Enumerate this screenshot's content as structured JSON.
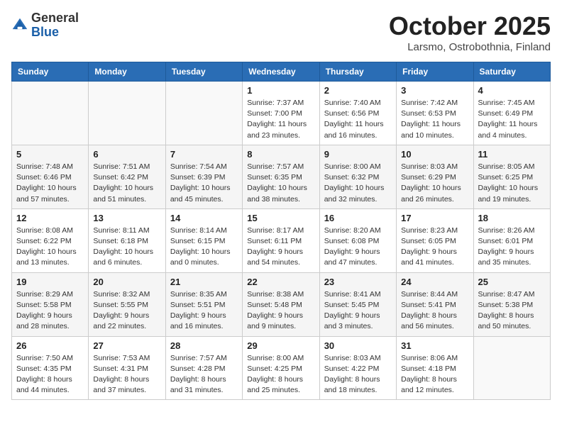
{
  "header": {
    "logo_general": "General",
    "logo_blue": "Blue",
    "month_title": "October 2025",
    "location": "Larsmo, Ostrobothnia, Finland"
  },
  "weekdays": [
    "Sunday",
    "Monday",
    "Tuesday",
    "Wednesday",
    "Thursday",
    "Friday",
    "Saturday"
  ],
  "weeks": [
    [
      {
        "day": "",
        "info": ""
      },
      {
        "day": "",
        "info": ""
      },
      {
        "day": "",
        "info": ""
      },
      {
        "day": "1",
        "info": "Sunrise: 7:37 AM\nSunset: 7:00 PM\nDaylight: 11 hours\nand 23 minutes."
      },
      {
        "day": "2",
        "info": "Sunrise: 7:40 AM\nSunset: 6:56 PM\nDaylight: 11 hours\nand 16 minutes."
      },
      {
        "day": "3",
        "info": "Sunrise: 7:42 AM\nSunset: 6:53 PM\nDaylight: 11 hours\nand 10 minutes."
      },
      {
        "day": "4",
        "info": "Sunrise: 7:45 AM\nSunset: 6:49 PM\nDaylight: 11 hours\nand 4 minutes."
      }
    ],
    [
      {
        "day": "5",
        "info": "Sunrise: 7:48 AM\nSunset: 6:46 PM\nDaylight: 10 hours\nand 57 minutes."
      },
      {
        "day": "6",
        "info": "Sunrise: 7:51 AM\nSunset: 6:42 PM\nDaylight: 10 hours\nand 51 minutes."
      },
      {
        "day": "7",
        "info": "Sunrise: 7:54 AM\nSunset: 6:39 PM\nDaylight: 10 hours\nand 45 minutes."
      },
      {
        "day": "8",
        "info": "Sunrise: 7:57 AM\nSunset: 6:35 PM\nDaylight: 10 hours\nand 38 minutes."
      },
      {
        "day": "9",
        "info": "Sunrise: 8:00 AM\nSunset: 6:32 PM\nDaylight: 10 hours\nand 32 minutes."
      },
      {
        "day": "10",
        "info": "Sunrise: 8:03 AM\nSunset: 6:29 PM\nDaylight: 10 hours\nand 26 minutes."
      },
      {
        "day": "11",
        "info": "Sunrise: 8:05 AM\nSunset: 6:25 PM\nDaylight: 10 hours\nand 19 minutes."
      }
    ],
    [
      {
        "day": "12",
        "info": "Sunrise: 8:08 AM\nSunset: 6:22 PM\nDaylight: 10 hours\nand 13 minutes."
      },
      {
        "day": "13",
        "info": "Sunrise: 8:11 AM\nSunset: 6:18 PM\nDaylight: 10 hours\nand 6 minutes."
      },
      {
        "day": "14",
        "info": "Sunrise: 8:14 AM\nSunset: 6:15 PM\nDaylight: 10 hours\nand 0 minutes."
      },
      {
        "day": "15",
        "info": "Sunrise: 8:17 AM\nSunset: 6:11 PM\nDaylight: 9 hours\nand 54 minutes."
      },
      {
        "day": "16",
        "info": "Sunrise: 8:20 AM\nSunset: 6:08 PM\nDaylight: 9 hours\nand 47 minutes."
      },
      {
        "day": "17",
        "info": "Sunrise: 8:23 AM\nSunset: 6:05 PM\nDaylight: 9 hours\nand 41 minutes."
      },
      {
        "day": "18",
        "info": "Sunrise: 8:26 AM\nSunset: 6:01 PM\nDaylight: 9 hours\nand 35 minutes."
      }
    ],
    [
      {
        "day": "19",
        "info": "Sunrise: 8:29 AM\nSunset: 5:58 PM\nDaylight: 9 hours\nand 28 minutes."
      },
      {
        "day": "20",
        "info": "Sunrise: 8:32 AM\nSunset: 5:55 PM\nDaylight: 9 hours\nand 22 minutes."
      },
      {
        "day": "21",
        "info": "Sunrise: 8:35 AM\nSunset: 5:51 PM\nDaylight: 9 hours\nand 16 minutes."
      },
      {
        "day": "22",
        "info": "Sunrise: 8:38 AM\nSunset: 5:48 PM\nDaylight: 9 hours\nand 9 minutes."
      },
      {
        "day": "23",
        "info": "Sunrise: 8:41 AM\nSunset: 5:45 PM\nDaylight: 9 hours\nand 3 minutes."
      },
      {
        "day": "24",
        "info": "Sunrise: 8:44 AM\nSunset: 5:41 PM\nDaylight: 8 hours\nand 56 minutes."
      },
      {
        "day": "25",
        "info": "Sunrise: 8:47 AM\nSunset: 5:38 PM\nDaylight: 8 hours\nand 50 minutes."
      }
    ],
    [
      {
        "day": "26",
        "info": "Sunrise: 7:50 AM\nSunset: 4:35 PM\nDaylight: 8 hours\nand 44 minutes."
      },
      {
        "day": "27",
        "info": "Sunrise: 7:53 AM\nSunset: 4:31 PM\nDaylight: 8 hours\nand 37 minutes."
      },
      {
        "day": "28",
        "info": "Sunrise: 7:57 AM\nSunset: 4:28 PM\nDaylight: 8 hours\nand 31 minutes."
      },
      {
        "day": "29",
        "info": "Sunrise: 8:00 AM\nSunset: 4:25 PM\nDaylight: 8 hours\nand 25 minutes."
      },
      {
        "day": "30",
        "info": "Sunrise: 8:03 AM\nSunset: 4:22 PM\nDaylight: 8 hours\nand 18 minutes."
      },
      {
        "day": "31",
        "info": "Sunrise: 8:06 AM\nSunset: 4:18 PM\nDaylight: 8 hours\nand 12 minutes."
      },
      {
        "day": "",
        "info": ""
      }
    ]
  ]
}
